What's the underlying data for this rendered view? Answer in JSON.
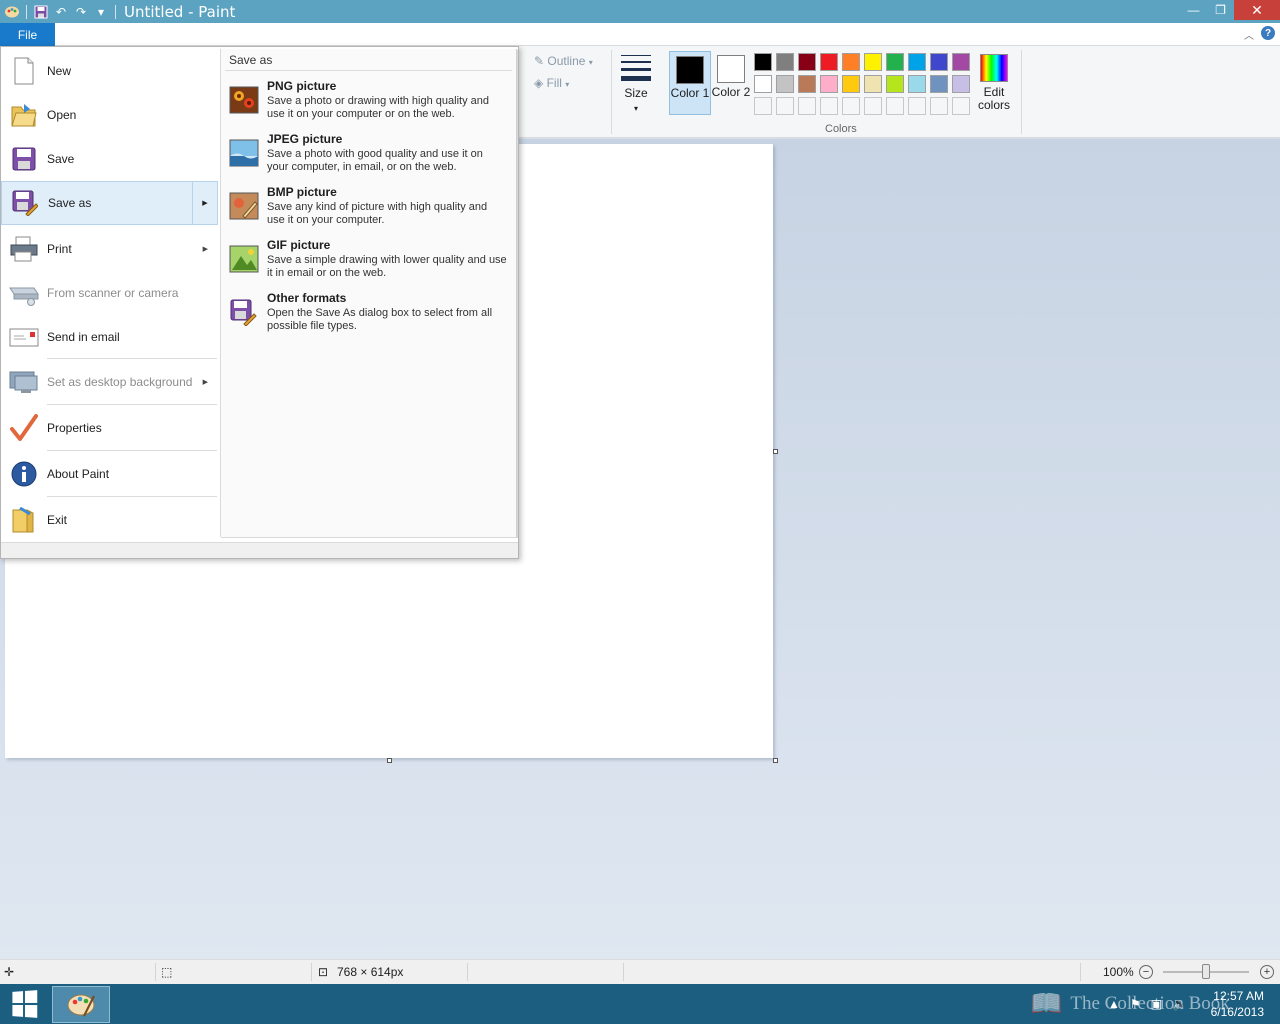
{
  "window": {
    "title": "Untitled - Paint",
    "controls": {
      "minimize": "—",
      "restore": "❐",
      "close": "✕"
    }
  },
  "qat": {
    "undo": "↶",
    "redo": "↷",
    "customize": "▾"
  },
  "ribbon": {
    "file_tab": "File",
    "outline_label": "Outline",
    "fill_label": "Fill",
    "size_label": "Size",
    "color1_label": "Color 1",
    "color2_label": "Color 2",
    "color1_value": "#000000",
    "color2_value": "#ffffff",
    "colors_group_label": "Colors",
    "edit_colors_label": "Edit colors",
    "palette": [
      "#000000",
      "#7f7f7f",
      "#880015",
      "#ed1c24",
      "#ff7f27",
      "#fff200",
      "#22b14c",
      "#00a2e8",
      "#3f48cc",
      "#a349a4",
      "#ffffff",
      "#c3c3c3",
      "#b97a57",
      "#ffaec9",
      "#ffc90e",
      "#efe4b0",
      "#b5e61d",
      "#99d9ea",
      "#7092be",
      "#c8bfe7"
    ]
  },
  "file_menu": {
    "items": [
      {
        "label": "New",
        "icon": "new-file-icon"
      },
      {
        "label": "Open",
        "icon": "open-folder-icon"
      },
      {
        "label": "Save",
        "icon": "save-icon"
      },
      {
        "label": "Save as",
        "icon": "save-as-icon"
      },
      {
        "label": "Print",
        "icon": "printer-icon"
      },
      {
        "label": "From scanner or camera",
        "icon": "scanner-icon"
      },
      {
        "label": "Send in email",
        "icon": "email-icon"
      },
      {
        "label": "Set as desktop background",
        "icon": "desktop-icon"
      },
      {
        "label": "Properties",
        "icon": "checkmark-icon"
      },
      {
        "label": "About Paint",
        "icon": "info-icon"
      },
      {
        "label": "Exit",
        "icon": "exit-icon"
      }
    ],
    "save_as_panel": {
      "title": "Save as",
      "formats": [
        {
          "title": "PNG picture",
          "description": "Save a photo or drawing with high quality and use it on your computer or on the web."
        },
        {
          "title": "JPEG picture",
          "description": "Save a photo with good quality and use it on your computer, in email, or on the web."
        },
        {
          "title": "BMP picture",
          "description": "Save any kind of picture with high quality and use it on your computer."
        },
        {
          "title": "GIF picture",
          "description": "Save a simple drawing with lower quality and use it in email or on the web."
        },
        {
          "title": "Other formats",
          "description": "Open the Save As dialog box to select from all possible file types."
        }
      ]
    }
  },
  "status_bar": {
    "canvas_size": "768 × 614px",
    "zoom_level": "100%",
    "zoom_fraction": 0.5
  },
  "taskbar": {
    "time": "12:57 AM",
    "date": "6/16/2013",
    "watermark": "The Collection Book"
  }
}
